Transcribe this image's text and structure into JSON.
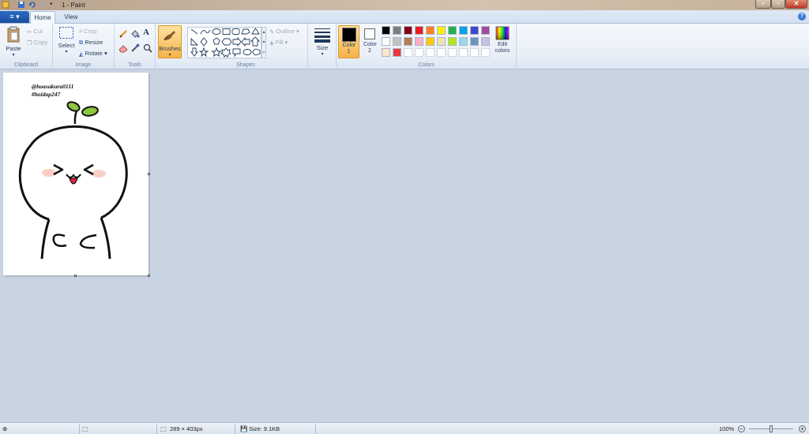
{
  "window": {
    "title": "1 - Paint"
  },
  "tabs": {
    "file": "≡ ▾",
    "home": "Home",
    "view": "View"
  },
  "clipboard": {
    "label": "Clipboard",
    "paste": "Paste",
    "cut": "Cut",
    "copy": "Copy"
  },
  "image": {
    "label": "Image",
    "select": "Select",
    "crop": "Crop",
    "resize": "Resize",
    "rotate": "Rotate"
  },
  "tools": {
    "label": "Tools"
  },
  "brushes": {
    "label": "Brushes"
  },
  "shapes": {
    "label": "Shapes",
    "outline": "Outline",
    "fill": "Fill"
  },
  "size": {
    "label": "Size"
  },
  "colors": {
    "label": "Colors",
    "color1": "Color 1",
    "color1_value": "#000000",
    "color2": "Color 2",
    "color2_value": "#ffffff",
    "edit": "Edit colors",
    "row1": [
      "#000000",
      "#7f7f7f",
      "#880015",
      "#ed1c24",
      "#ff7f27",
      "#fff200",
      "#22b14c",
      "#00a2e8",
      "#3f48cc",
      "#a349a4"
    ],
    "row2": [
      "#ffffff",
      "#c3c3c3",
      "#b97a57",
      "#ffaec9",
      "#ffc90e",
      "#efe4b0",
      "#b5e61d",
      "#99d9ea",
      "#7092be",
      "#c8bfe7"
    ],
    "row3": [
      "#ffe4c9",
      "#e8373d"
    ]
  },
  "drawing": {
    "line1": "@hoasakura0111",
    "line2": "#hoidap247"
  },
  "status": {
    "dimensions": "289 × 403px",
    "size": "Size: 9.1KB",
    "zoom": "100%"
  }
}
